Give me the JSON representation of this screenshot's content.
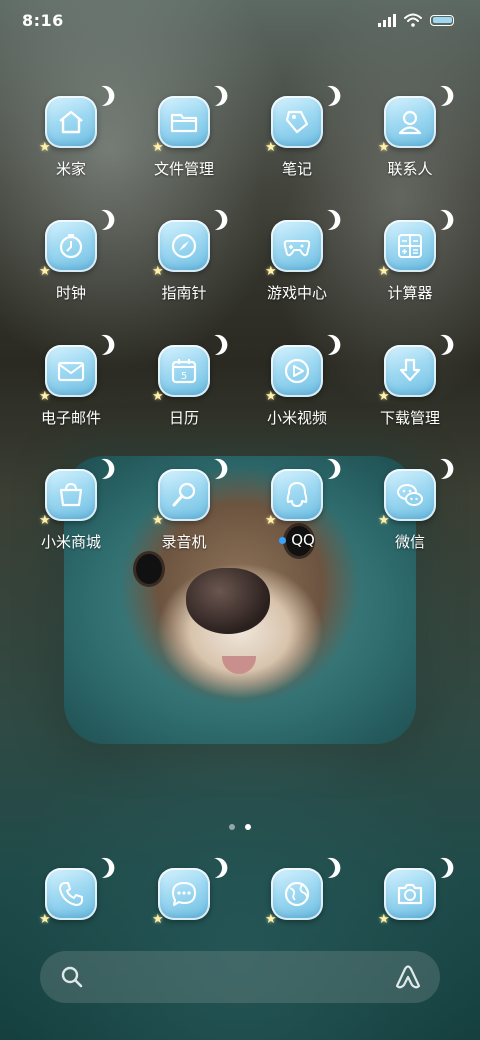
{
  "status_bar": {
    "time": "8:16"
  },
  "apps": [
    {
      "label": "米家",
      "icon": "home-icon"
    },
    {
      "label": "文件管理",
      "icon": "folder-icon"
    },
    {
      "label": "笔记",
      "icon": "note-tag-icon"
    },
    {
      "label": "联系人",
      "icon": "contact-icon"
    },
    {
      "label": "时钟",
      "icon": "clock-icon"
    },
    {
      "label": "指南针",
      "icon": "compass-icon"
    },
    {
      "label": "游戏中心",
      "icon": "gamepad-icon"
    },
    {
      "label": "计算器",
      "icon": "calculator-icon"
    },
    {
      "label": "电子邮件",
      "icon": "mail-icon"
    },
    {
      "label": "日历",
      "icon": "calendar-icon",
      "calendar_day": "5"
    },
    {
      "label": "小米视频",
      "icon": "play-icon"
    },
    {
      "label": "下载管理",
      "icon": "download-icon"
    },
    {
      "label": "小米商城",
      "icon": "shopping-bag-icon"
    },
    {
      "label": "录音机",
      "icon": "microphone-icon"
    },
    {
      "label": "QQ",
      "icon": "qq-penguin-icon",
      "has_notification_dot": true
    },
    {
      "label": "微信",
      "icon": "wechat-icon"
    }
  ],
  "dock": [
    {
      "icon": "phone-icon"
    },
    {
      "icon": "message-icon"
    },
    {
      "icon": "browser-icon"
    },
    {
      "icon": "camera-icon"
    }
  ],
  "pager": {
    "pages": 2,
    "active": 2
  },
  "colors": {
    "icon_tile": "#9fd9f2",
    "notification_dot": "#3aa3ff"
  }
}
